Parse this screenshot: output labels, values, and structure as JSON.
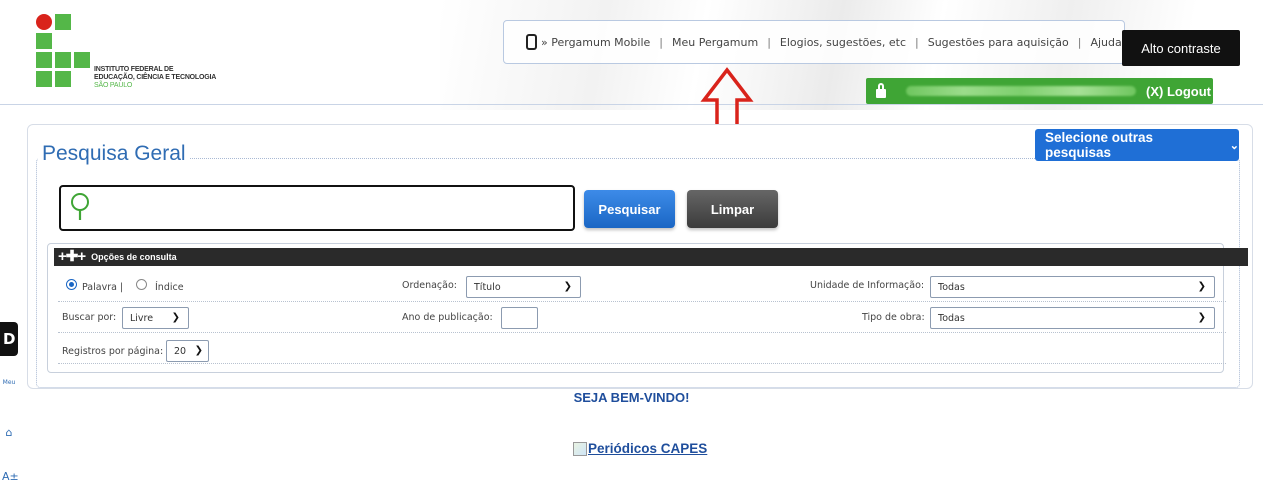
{
  "logo": {
    "line1": "INSTITUTO FEDERAL DE",
    "line2": "EDUCAÇÃO, CIÊNCIA E TECNOLOGIA",
    "line3": "SÃO PAULO"
  },
  "topnav": {
    "items": [
      "» Pergamum Mobile",
      "Meu Pergamum",
      "Elogios, sugestões, etc",
      "Sugestões para aquisição",
      "Ajuda"
    ],
    "icon": "phone-icon"
  },
  "alto_contraste": "Alto contraste",
  "logout": {
    "label": "(X) Logout",
    "icon": "lock-icon"
  },
  "search": {
    "title": "Pesquisa Geral",
    "other_searches": "Selecione outras pesquisas",
    "input_value": "",
    "search_button": "Pesquisar",
    "clear_button": "Limpar"
  },
  "options": {
    "header": "Opções de consulta",
    "radio_palavra": "Palavra |",
    "radio_indice": "Índice",
    "ordenacao_label": "Ordenação:",
    "ordenacao_value": "Título",
    "unidade_label": "Unidade de Informação:",
    "unidade_value": "Todas",
    "buscar_label": "Buscar por:",
    "buscar_value": "Livre",
    "ano_label": "Ano de publicação:",
    "ano_value": "",
    "tipo_label": "Tipo de obra:",
    "tipo_value": "Todas",
    "registros_label": "Registros por página:",
    "registros_value": "20"
  },
  "welcome": "SEJA BEM-VINDO!",
  "capes_link": "Periódicos CAPES",
  "sidebar": {
    "tab_label": "D",
    "item2": "Meu"
  },
  "colors": {
    "accent": "#1f6fd6",
    "green": "#3fa535",
    "title": "#2f6cb3",
    "arrow": "#d9231b"
  }
}
